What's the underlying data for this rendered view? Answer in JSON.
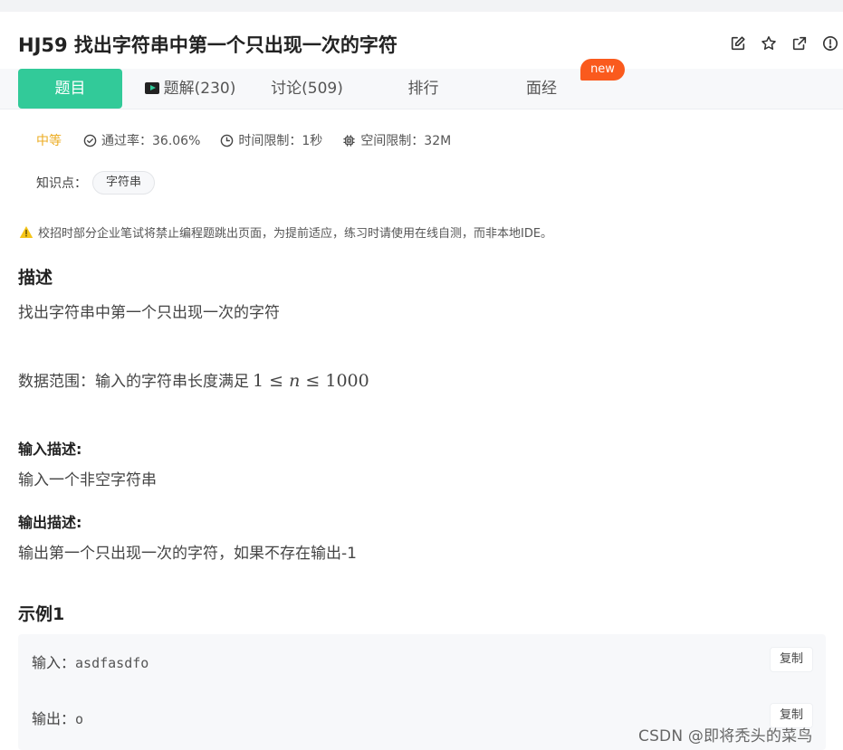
{
  "header": {
    "title": "HJ59  找出字符串中第一个只出现一次的字符",
    "actions": [
      "edit-icon",
      "star-icon",
      "share-icon",
      "info-icon"
    ]
  },
  "tabs": [
    {
      "label": "题目",
      "active": true
    },
    {
      "label": "题解(230)",
      "icon": "video-icon"
    },
    {
      "label": "讨论(509)"
    },
    {
      "label": "排行"
    },
    {
      "label": "面经",
      "badge": "new"
    }
  ],
  "meta": {
    "difficulty": "中等",
    "pass_rate": "通过率：36.06%",
    "time_limit": "时间限制：1秒",
    "memory_limit": "空间限制：32M"
  },
  "knowledge": {
    "label": "知识点：",
    "tags": [
      "字符串"
    ]
  },
  "notice": "校招时部分企业笔试将禁止编程题跳出页面，为提前适应，练习时请使用在线自测，而非本地IDE。",
  "description": {
    "heading": "描述",
    "text": "找出字符串中第一个只出现一次的字符",
    "range_prefix": "数据范围：输入的字符串长度满足",
    "range_math": {
      "low": "1",
      "var": "n",
      "high": "1000",
      "op": "≤"
    }
  },
  "input_desc": {
    "heading": "输入描述:",
    "text": "输入一个非空字符串"
  },
  "output_desc": {
    "heading": "输出描述:",
    "text": "输出第一个只出现一次的字符，如果不存在输出-1"
  },
  "example": {
    "heading": "示例1",
    "input_label": "输入：",
    "input_value": "asdfasdfo",
    "output_label": "输出：",
    "output_value": "o",
    "copy_label": "复制"
  },
  "watermark": "CSDN @即将秃头的菜鸟",
  "colors": {
    "accent": "#32ca99",
    "badge": "#fa5a1d",
    "difficulty": "#ecac21",
    "warning": "#f5c518"
  }
}
